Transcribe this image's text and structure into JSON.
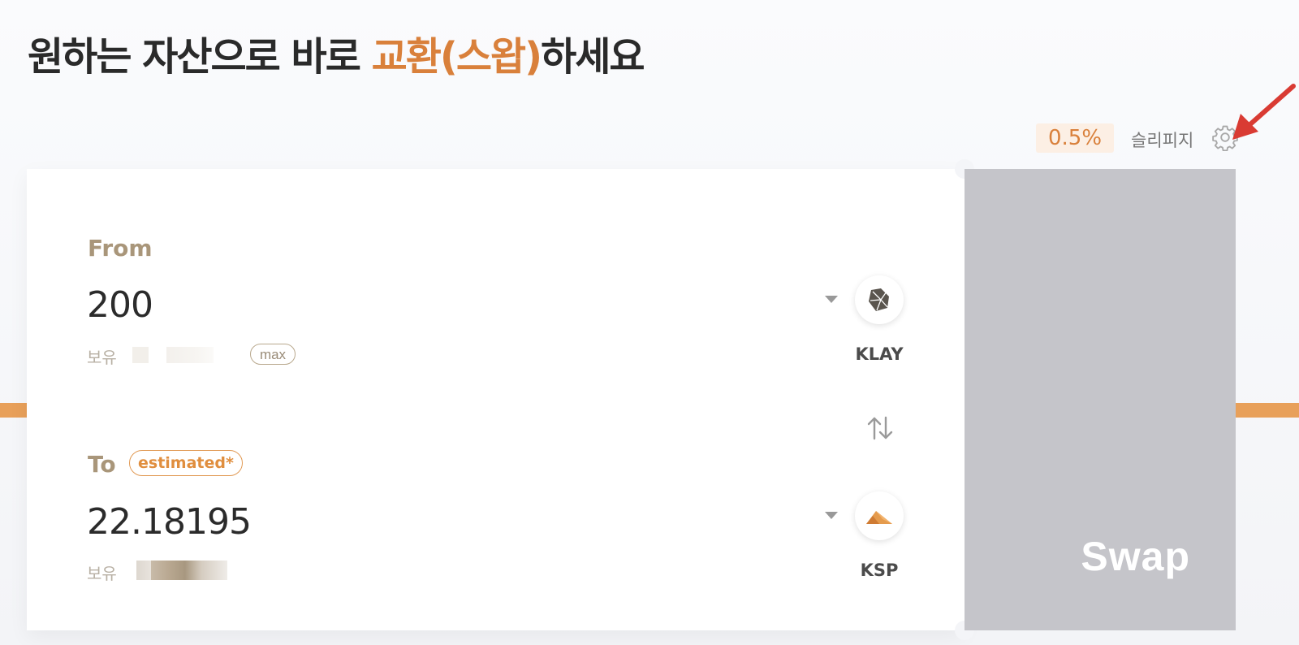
{
  "header": {
    "title_prefix": "원하는 자산으로 바로 ",
    "title_accent": "교환(스왑)",
    "title_suffix": "하세요"
  },
  "settings": {
    "slippage_value": "0.5%",
    "slippage_label": "슬리피지",
    "gear_icon": "gear-icon"
  },
  "swap": {
    "from": {
      "label": "From",
      "amount": "200",
      "holding_label": "보유",
      "max_label": "max",
      "token": "KLAY",
      "token_icon": "klay-logo-icon"
    },
    "to": {
      "label": "To",
      "estimated_label": "estimated*",
      "amount": "22.18195",
      "holding_label": "보유",
      "token": "KSP",
      "token_icon": "ksp-logo-icon"
    },
    "direction_icon": "swap-arrows-icon",
    "button_label": "Swap"
  },
  "colors": {
    "accent": "#d9803b",
    "label_tan": "#a9967a",
    "swap_disabled": "#c5c5ca",
    "band": "#e8a05a",
    "annotation_arrow": "#d93b33"
  }
}
